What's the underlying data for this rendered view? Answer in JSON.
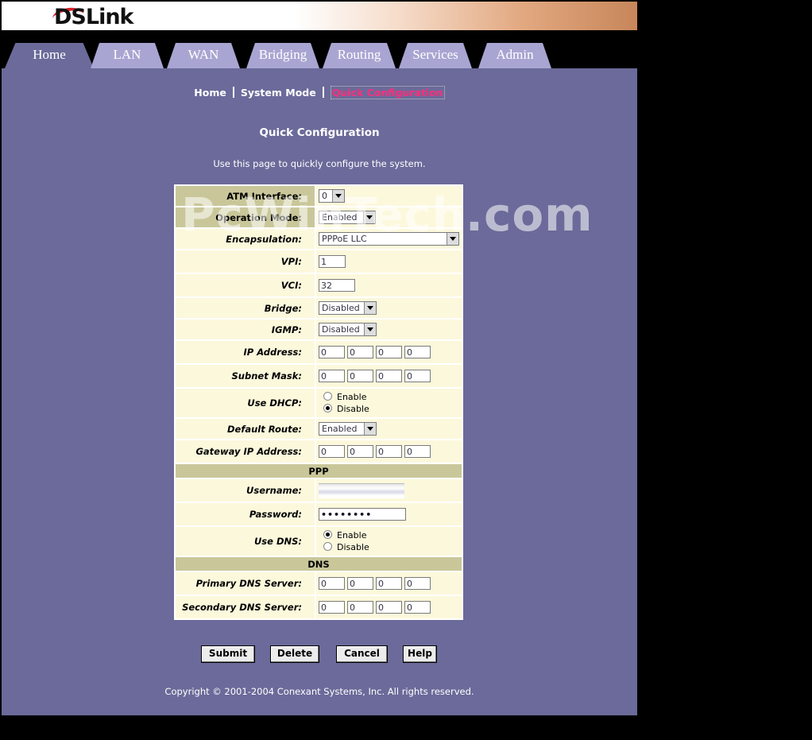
{
  "brand": {
    "logo_text": "DSLink"
  },
  "tabs": [
    {
      "label": "Home",
      "active": true
    },
    {
      "label": "LAN"
    },
    {
      "label": "WAN"
    },
    {
      "label": "Bridging"
    },
    {
      "label": "Routing"
    },
    {
      "label": "Services"
    },
    {
      "label": "Admin"
    }
  ],
  "breadcrumb": {
    "home": "Home",
    "system_mode": "System Mode",
    "current": "Quick Configuration"
  },
  "page": {
    "title": "Quick Configuration",
    "description": "Use this page to quickly configure the system."
  },
  "watermark": "PcWinTech.com",
  "form": {
    "atm_interface": {
      "label": "ATM Interface:",
      "value": "0"
    },
    "operation_mode": {
      "label": "Operation Mode:",
      "value": "Enabled"
    },
    "encapsulation": {
      "label": "Encapsulation:",
      "value": "PPPoE LLC"
    },
    "vpi": {
      "label": "VPI:",
      "value": "1"
    },
    "vci": {
      "label": "VCI:",
      "value": "32"
    },
    "bridge": {
      "label": "Bridge:",
      "value": "Disabled"
    },
    "igmp": {
      "label": "IGMP:",
      "value": "Disabled"
    },
    "ip_address": {
      "label": "IP Address:",
      "octets": [
        "0",
        "0",
        "0",
        "0"
      ]
    },
    "subnet_mask": {
      "label": "Subnet Mask:",
      "octets": [
        "0",
        "0",
        "0",
        "0"
      ]
    },
    "use_dhcp": {
      "label": "Use DHCP:",
      "enable": "Enable",
      "disable": "Disable",
      "selected": "Disable"
    },
    "default_route": {
      "label": "Default Route:",
      "value": "Enabled"
    },
    "gateway_ip": {
      "label": "Gateway IP Address:",
      "octets": [
        "0",
        "0",
        "0",
        "0"
      ]
    },
    "ppp_section": "PPP",
    "username": {
      "label": "Username:"
    },
    "password": {
      "label": "Password:",
      "value": "••••••••"
    },
    "use_dns": {
      "label": "Use DNS:",
      "enable": "Enable",
      "disable": "Disable",
      "selected": "Enable"
    },
    "dns_section": "DNS",
    "primary_dns": {
      "label": "Primary DNS Server:",
      "octets": [
        "0",
        "0",
        "0",
        "0"
      ]
    },
    "secondary_dns": {
      "label": "Secondary DNS Server:",
      "octets": [
        "0",
        "0",
        "0",
        "0"
      ]
    }
  },
  "buttons": {
    "submit": "Submit",
    "delete": "Delete",
    "cancel": "Cancel",
    "help": "Help"
  },
  "footer": {
    "copyright": "Copyright © 2001-2004 Conexant Systems, Inc. All rights reserved."
  },
  "colors": {
    "panel": "#6b6a9a",
    "tab": "#a8a5d2",
    "form_bg": "#fcf8dc",
    "section_bg": "#c9c79a",
    "active_link": "#ff2e7a"
  }
}
